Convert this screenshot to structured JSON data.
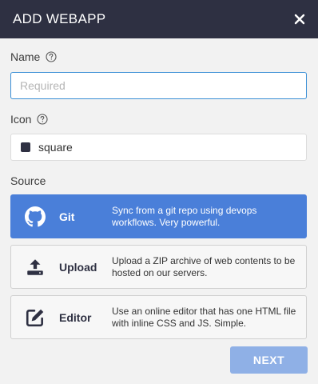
{
  "dialog": {
    "title": "ADD WEBAPP",
    "close_icon": "close-icon"
  },
  "name_field": {
    "label": "Name",
    "placeholder": "Required",
    "value": "",
    "help_icon": "question-circle-icon"
  },
  "icon_field": {
    "label": "Icon",
    "help_icon": "question-circle-icon",
    "selected_icon": "square-icon",
    "selected_value": "square"
  },
  "source": {
    "label": "Source",
    "options": [
      {
        "name": "Git",
        "icon": "github-icon",
        "description": "Sync from a git repo using devops workflows. Very powerful.",
        "selected": true
      },
      {
        "name": "Upload",
        "icon": "upload-icon",
        "description": "Upload a ZIP archive of web contents to be hosted on our servers.",
        "selected": false
      },
      {
        "name": "Editor",
        "icon": "edit-icon",
        "description": "Use an online editor that has one HTML file with inline CSS and JS. Simple.",
        "selected": false
      }
    ]
  },
  "footer": {
    "next_label": "NEXT"
  },
  "colors": {
    "header_bg": "#2e3042",
    "selected_option_bg": "#4a7fd9",
    "next_button_bg": "#8fb0e6",
    "input_focus_border": "#3a8fd6"
  }
}
